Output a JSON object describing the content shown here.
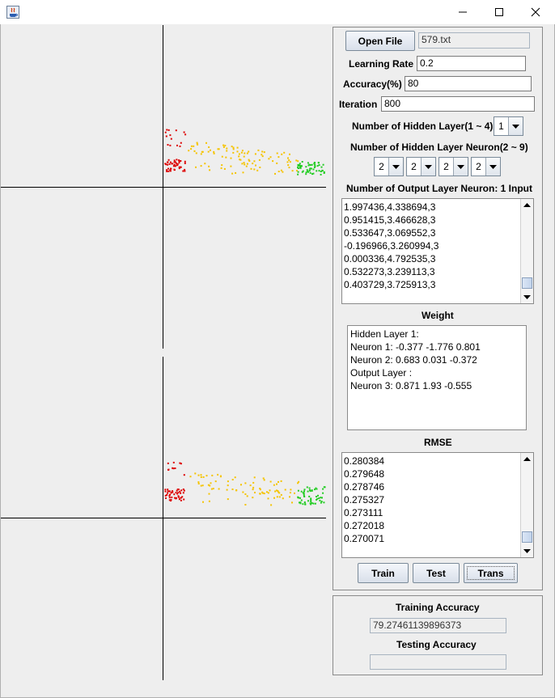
{
  "titlebar": {
    "icon": "java-app-icon"
  },
  "controls": {
    "open_file_label": "Open File",
    "file_name": "579.txt",
    "learning_rate_label": "Learning Rate",
    "learning_rate_value": "0.2",
    "accuracy_label": "Accuracy(%)",
    "accuracy_value": "80",
    "iteration_label": "Iteration",
    "iteration_value": "800",
    "hidden_layers_label": "Number of Hidden Layer(1 ~ 4)",
    "hidden_layers_value": "1",
    "hidden_neuron_label": "Number of Hidden Layer Neuron(2 ~ 9)",
    "hidden_neuron_values": [
      "2",
      "2",
      "2",
      "2"
    ],
    "output_neuron_label": "Number of Output Layer Neuron: 1  Input"
  },
  "input_lines": [
    "1.997436,4.338694,3",
    "0.951415,3.466628,3",
    "0.533647,3.069552,3",
    "-0.196966,3.260994,3",
    "0.000336,4.792535,3",
    "0.532273,3.239113,3",
    "0.403729,3.725913,3"
  ],
  "weight": {
    "label": "Weight",
    "lines": [
      "Hidden Layer 1:",
      "Neuron 1: -0.377 -1.776 0.801",
      "Neuron 2: 0.683 0.031 -0.372",
      "Output Layer :",
      "Neuron 3: 0.871 1.93 -0.555"
    ]
  },
  "rmse": {
    "label": "RMSE",
    "lines": [
      "0.280384",
      "0.279648",
      "0.278746",
      "0.275327",
      "0.273111",
      "0.272018",
      "0.270071"
    ]
  },
  "actions": {
    "train": "Train",
    "test": "Test",
    "trans": "Trans"
  },
  "results": {
    "training_label": "Training Accuracy",
    "training_value": "79.27461139896373",
    "testing_label": "Testing Accuracy",
    "testing_value": ""
  },
  "colors": {
    "class_1": "#dd0000",
    "class_2": "#f5c400",
    "class_3": "#22cc22"
  }
}
